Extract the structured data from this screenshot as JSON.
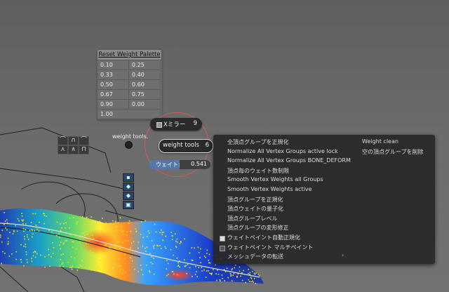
{
  "palette": {
    "title": "Reset Weight Palette",
    "values": [
      "0.10",
      "0.25",
      "0.33",
      "0.40",
      "0.50",
      "0.60",
      "0.67",
      "0.75",
      "0.90",
      "0.00"
    ],
    "last": "1.00"
  },
  "x_mirror": {
    "label": "Xミラー",
    "value": "9"
  },
  "weight_tools": {
    "label": "weight tools",
    "value": "6",
    "side_label": "weight tools."
  },
  "weight": {
    "label": "ウェイト:",
    "value": "0.541",
    "fraction": 0.5
  },
  "curve_icons": [
    "smooth-falloff-icon",
    "sphere-falloff-icon",
    "root-falloff-icon",
    "sharp-falloff-icon",
    "linear-falloff-icon",
    "constant-falloff-icon"
  ],
  "tool_icons": [
    "vertex-select-icon",
    "brush-icon",
    "brush-draw-icon",
    "bucket-icon"
  ],
  "menu": {
    "left": [
      {
        "label": "全頂点グループを正規化"
      },
      {
        "label": "Normalize All Vertex Groups active lock"
      },
      {
        "label": "Normalize All Vertex Groups BONE_DEFORM"
      },
      {
        "label": "頂点毎のウェイト数制限"
      },
      {
        "label": "Smooth Vertex Weights all Groups"
      },
      {
        "label": "Smooth Vertex Weights active"
      },
      {
        "label": "頂点グループを正規化"
      },
      {
        "label": "頂点ウェイトの量子化"
      },
      {
        "label": "頂点グループレベル"
      },
      {
        "label": "頂点グループの変形修正"
      },
      {
        "label": "ウェイトペイント自動正規化",
        "checked": true
      },
      {
        "label": "ウェイトペイント マルチペイント",
        "checked": false
      },
      {
        "label": "メッシュデータの転送",
        "submenu": true
      }
    ],
    "right": [
      {
        "label": "Weight clean"
      },
      {
        "label": "空の頂点グループを削除"
      }
    ]
  }
}
